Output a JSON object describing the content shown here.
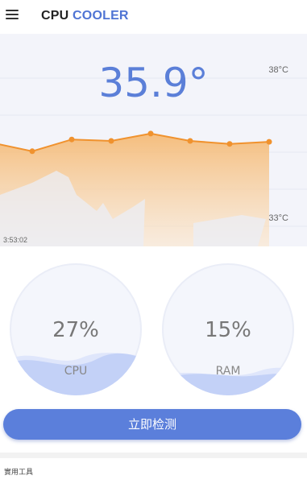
{
  "app": {
    "title_part1": "CPU",
    "title_part2": "COOLER"
  },
  "temperature": {
    "current": "35.9°",
    "max_label": "38°C",
    "min_label": "33°C",
    "time_label": "3:53:02",
    "points_celsius": [
      35.6,
      35.3,
      35.7,
      35.65,
      35.9,
      35.65,
      35.55,
      35.62
    ]
  },
  "gauges": [
    {
      "percent": "27%",
      "label": "CPU",
      "level": 0.27
    },
    {
      "percent": "15%",
      "label": "RAM",
      "level": 0.15
    }
  ],
  "actions": {
    "detect_label": "立即检测"
  },
  "tools": {
    "section_title": "實用工具"
  },
  "colors": {
    "accent": "#5b7fd8",
    "line": "#f0922e",
    "fill": "#f7c98c"
  }
}
